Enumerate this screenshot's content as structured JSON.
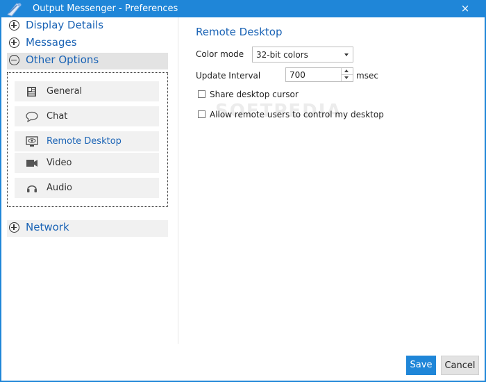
{
  "window": {
    "title": "Output Messenger - Preferences",
    "close_glyph": "×",
    "accent_color": "#1f86d8"
  },
  "sidebar": {
    "sections": [
      {
        "label": "Display Details",
        "state": "collapsed",
        "icon": "plus-circle-icon"
      },
      {
        "label": "Messages",
        "state": "collapsed",
        "icon": "plus-circle-icon"
      },
      {
        "label": "Other Options",
        "state": "expanded",
        "icon": "minus-circle-icon"
      },
      {
        "label": "Network",
        "state": "collapsed",
        "icon": "plus-circle-icon"
      }
    ],
    "sub_items": [
      {
        "label": "General",
        "icon": "general-icon"
      },
      {
        "label": "Chat",
        "icon": "chat-bubble-icon"
      },
      {
        "label": "Remote Desktop",
        "icon": "monitor-eye-icon",
        "active": true
      },
      {
        "label": "Video",
        "icon": "video-camera-icon"
      },
      {
        "label": "Audio",
        "icon": "headset-icon"
      }
    ]
  },
  "main": {
    "title": "Remote Desktop",
    "color_mode": {
      "label": "Color mode",
      "value": "32-bit colors"
    },
    "update_interval": {
      "label": "Update Interval",
      "value": "700",
      "unit": "msec"
    },
    "checkboxes": [
      {
        "label": "Share desktop cursor",
        "checked": false
      },
      {
        "label": "Allow remote users to control my desktop",
        "checked": false
      }
    ],
    "watermark": "SOFTPEDIA"
  },
  "footer": {
    "save_label": "Save",
    "cancel_label": "Cancel"
  }
}
